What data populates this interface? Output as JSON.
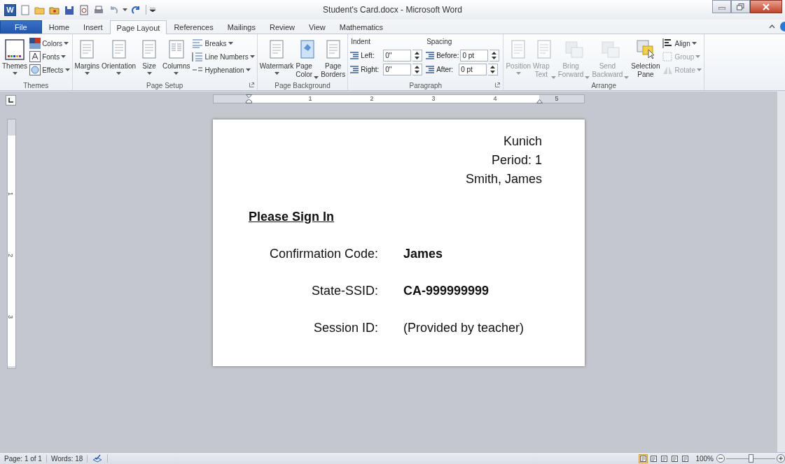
{
  "window": {
    "app_letter": "W",
    "title": "Student's Card.docx - Microsoft Word"
  },
  "tabs": [
    {
      "label": "File",
      "kind": "file",
      "selected": false
    },
    {
      "label": "Home",
      "kind": "tab",
      "selected": false
    },
    {
      "label": "Insert",
      "kind": "tab",
      "selected": false
    },
    {
      "label": "Page Layout",
      "kind": "tab",
      "selected": true
    },
    {
      "label": "References",
      "kind": "tab",
      "selected": false
    },
    {
      "label": "Mailings",
      "kind": "tab",
      "selected": false
    },
    {
      "label": "Review",
      "kind": "tab",
      "selected": false
    },
    {
      "label": "View",
      "kind": "tab",
      "selected": false
    },
    {
      "label": "Mathematics",
      "kind": "tab",
      "selected": false
    }
  ],
  "ribbon": [
    {
      "label": "Themes",
      "launcher": false,
      "columns": [
        [
          {
            "kind": "large",
            "label": "Themes",
            "menu": true,
            "disabled": false
          }
        ],
        [
          {
            "kind": "small",
            "label": "Colors",
            "menu": true,
            "disabled": false
          },
          {
            "kind": "small",
            "label": "Fonts",
            "menu": true,
            "disabled": false
          },
          {
            "kind": "small",
            "label": "Effects",
            "menu": true,
            "disabled": false
          }
        ]
      ]
    },
    {
      "label": "Page Setup",
      "launcher": true,
      "columns": [
        [
          {
            "kind": "large",
            "label": "Margins",
            "menu": true,
            "disabled": false
          }
        ],
        [
          {
            "kind": "large",
            "label": "Orientation",
            "menu": true,
            "disabled": false
          }
        ],
        [
          {
            "kind": "large",
            "label": "Size",
            "menu": true,
            "disabled": false
          }
        ],
        [
          {
            "kind": "large",
            "label": "Columns",
            "menu": true,
            "disabled": false
          }
        ],
        [
          {
            "kind": "small",
            "label": "Breaks",
            "menu": true,
            "disabled": false
          },
          {
            "kind": "small",
            "label": "Line Numbers",
            "menu": true,
            "disabled": false
          },
          {
            "kind": "small",
            "label": "Hyphenation",
            "menu": true,
            "disabled": false
          }
        ]
      ]
    },
    {
      "label": "Page Background",
      "launcher": false,
      "columns": [
        [
          {
            "kind": "large",
            "label": "Watermark",
            "menu": true,
            "disabled": false
          }
        ],
        [
          {
            "kind": "large",
            "label": "Page\nColor",
            "menu": true,
            "disabled": false
          }
        ],
        [
          {
            "kind": "large",
            "label": "Page\nBorders",
            "menu": false,
            "disabled": false
          }
        ]
      ]
    },
    {
      "label": "Paragraph",
      "launcher": true,
      "columns": [
        [
          {
            "kind": "heading",
            "label": "Indent"
          },
          {
            "kind": "field",
            "label": "Left:",
            "value": "0\""
          },
          {
            "kind": "field",
            "label": "Right:",
            "value": "0\""
          }
        ],
        [
          {
            "kind": "heading",
            "label": "Spacing"
          },
          {
            "kind": "field",
            "label": "Before:",
            "value": "0 pt"
          },
          {
            "kind": "field",
            "label": "After:",
            "value": "0 pt"
          }
        ]
      ]
    },
    {
      "label": "Arrange",
      "launcher": false,
      "columns": [
        [
          {
            "kind": "large",
            "label": "Position",
            "menu": true,
            "disabled": true
          }
        ],
        [
          {
            "kind": "large",
            "label": "Wrap\nText",
            "menu": true,
            "disabled": true
          }
        ],
        [
          {
            "kind": "large",
            "label": "Bring\nForward",
            "menu": true,
            "disabled": true
          }
        ],
        [
          {
            "kind": "large",
            "label": "Send\nBackward",
            "menu": true,
            "disabled": true
          }
        ],
        [
          {
            "kind": "large",
            "label": "Selection\nPane",
            "menu": false,
            "disabled": false
          }
        ],
        [
          {
            "kind": "small",
            "label": "Align",
            "menu": true,
            "disabled": false
          },
          {
            "kind": "small",
            "label": "Group",
            "menu": true,
            "disabled": true
          },
          {
            "kind": "small",
            "label": "Rotate",
            "menu": true,
            "disabled": true
          }
        ]
      ]
    }
  ],
  "horizontal_ruler": {
    "labels": [
      "1",
      "2",
      "3",
      "4",
      "5"
    ]
  },
  "vertical_ruler": {
    "labels": [
      "1",
      "2",
      "3"
    ]
  },
  "document": {
    "header_lines": [
      "Kunich",
      "Period: 1",
      "Smith, James"
    ],
    "heading": "Please Sign In",
    "rows": [
      {
        "label": "Confirmation Code:",
        "value": "James",
        "bold": true
      },
      {
        "label": "State-SSID:",
        "value": "CA-999999999",
        "bold": true
      },
      {
        "label": "Session ID:",
        "value": "(Provided by teacher)",
        "bold": false
      }
    ]
  },
  "status_bar": {
    "page": "Page: 1 of 1",
    "words": "Words: 18",
    "views": [
      {
        "selected": true
      },
      {
        "selected": false
      },
      {
        "selected": false
      },
      {
        "selected": false
      },
      {
        "selected": false
      }
    ],
    "zoom": {
      "label": "100%",
      "level": 0.5
    }
  }
}
